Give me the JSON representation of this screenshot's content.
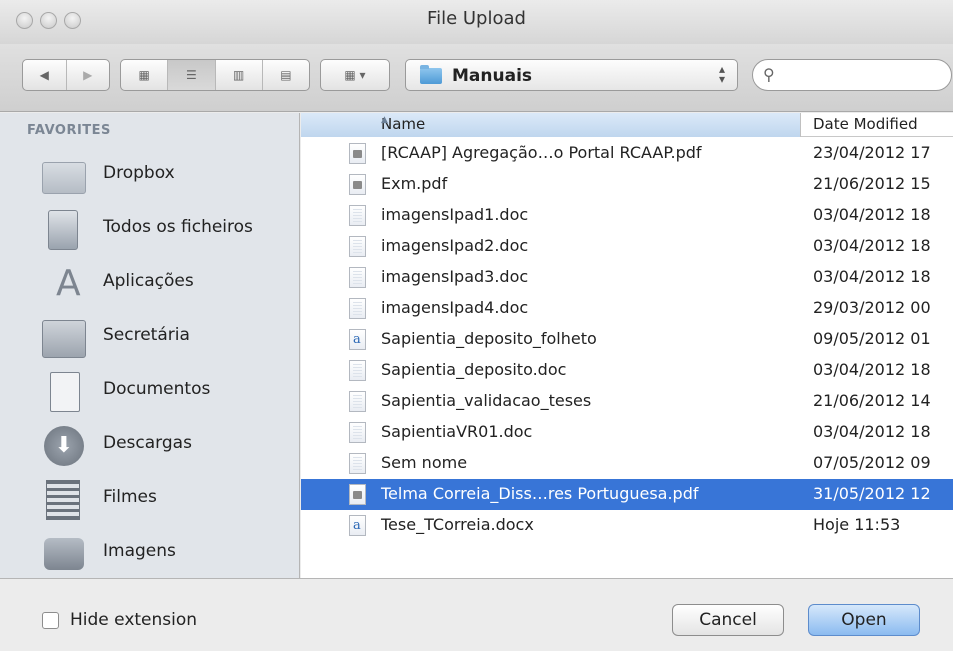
{
  "window": {
    "title": "File Upload"
  },
  "toolbar": {
    "back_icon": "chevron-left-icon",
    "forward_icon": "chevron-right-icon",
    "view_modes": [
      "icon-view",
      "list-view",
      "column-view",
      "coverflow-view"
    ],
    "active_view": "list-view",
    "arrange_icon": "arrange-grid-icon",
    "location": "Manuais"
  },
  "sidebar": {
    "header": "FAVORITES",
    "items": [
      {
        "label": "Dropbox",
        "icon": "folder-icon"
      },
      {
        "label": "Todos os ficheiros",
        "icon": "all-files-icon"
      },
      {
        "label": "Aplicações",
        "icon": "applications-icon"
      },
      {
        "label": "Secretária",
        "icon": "desktop-icon"
      },
      {
        "label": "Documentos",
        "icon": "documents-icon"
      },
      {
        "label": "Descargas",
        "icon": "downloads-icon"
      },
      {
        "label": "Filmes",
        "icon": "movies-icon"
      },
      {
        "label": "Imagens",
        "icon": "camera-icon"
      }
    ]
  },
  "files": {
    "columns": {
      "name": "Name",
      "date": "Date Modified"
    },
    "rows": [
      {
        "name": "[RCAAP] Agregação…o Portal RCAAP.pdf",
        "date": "23/04/2012 17",
        "type": "pdf",
        "selected": false
      },
      {
        "name": "Exm.pdf",
        "date": "21/06/2012 15",
        "type": "pdf",
        "selected": false
      },
      {
        "name": "imagensIpad1.doc",
        "date": "03/04/2012 18",
        "type": "doc",
        "selected": false
      },
      {
        "name": "imagensIpad2.doc",
        "date": "03/04/2012 18",
        "type": "doc",
        "selected": false
      },
      {
        "name": "imagensIpad3.doc",
        "date": "03/04/2012 18",
        "type": "doc",
        "selected": false
      },
      {
        "name": "imagensIpad4.doc",
        "date": "29/03/2012 00",
        "type": "doc",
        "selected": false
      },
      {
        "name": "Sapientia_deposito_folheto",
        "date": "09/05/2012 01",
        "type": "docx",
        "selected": false
      },
      {
        "name": "Sapientia_deposito.doc",
        "date": "03/04/2012 18",
        "type": "doc",
        "selected": false
      },
      {
        "name": "Sapientia_validacao_teses",
        "date": "21/06/2012 14",
        "type": "doc",
        "selected": false
      },
      {
        "name": "SapientiaVR01.doc",
        "date": "03/04/2012 18",
        "type": "doc",
        "selected": false
      },
      {
        "name": "Sem nome",
        "date": "07/05/2012 09",
        "type": "doc",
        "selected": false
      },
      {
        "name": "Telma Correia_Diss…res Portuguesa.pdf",
        "date": "31/05/2012 12",
        "type": "pdf",
        "selected": true
      },
      {
        "name": "Tese_TCorreia.docx",
        "date": "Hoje 11:53",
        "type": "docx",
        "selected": false
      }
    ]
  },
  "footer": {
    "hide_extension_label": "Hide extension",
    "hide_extension_checked": false,
    "cancel_label": "Cancel",
    "open_label": "Open"
  },
  "colors": {
    "selection": "#3875d7",
    "sidebar_bg": "#e1e5ea",
    "header_blue": "#bfd6ee"
  }
}
